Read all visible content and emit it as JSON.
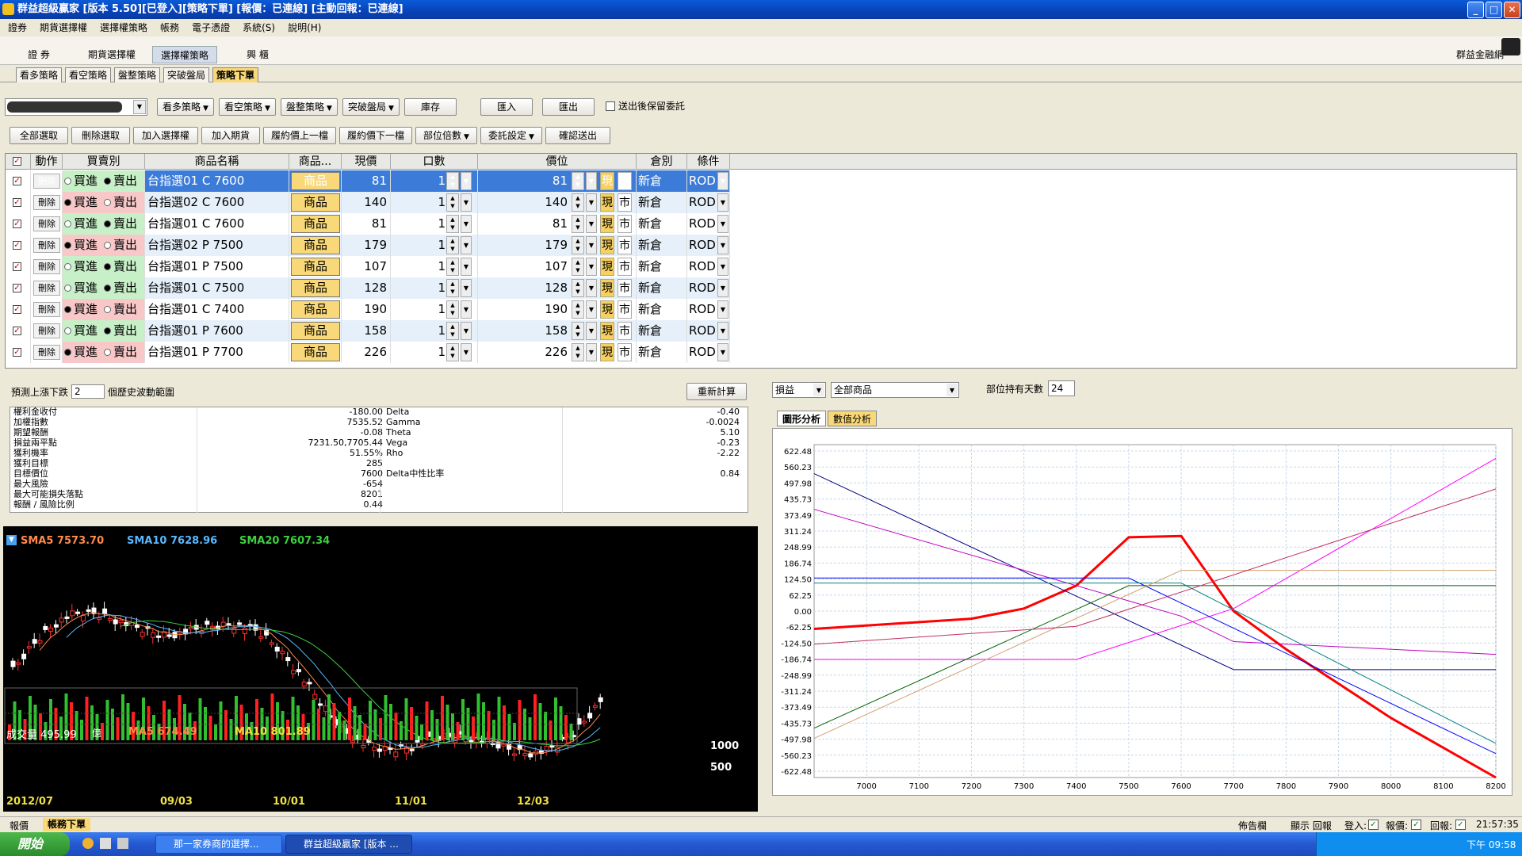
{
  "window": {
    "title": "群益超級贏家 [版本 5.50][已登入][策略下單] [報價：已連線] [主動回報：已連線]"
  },
  "menu": [
    "證券",
    "期貨選擇權",
    "選擇權策略",
    "帳務",
    "電子憑證",
    "系統(S)",
    "說明(H)"
  ],
  "main_tabs": [
    "證 券",
    "期貨選擇權",
    "選擇權策略",
    "興 櫃"
  ],
  "brand": "群益金融網",
  "strategy_tabs": [
    "看多策略",
    "看空策略",
    "盤整策略",
    "突破盤局",
    "策略下單"
  ],
  "toolbar1": [
    "看多策略",
    "看空策略",
    "盤整策略",
    "突破盤局",
    "庫存",
    "匯入",
    "匯出"
  ],
  "keep_order_label": "送出後保留委託",
  "toolbar2": [
    "全部選取",
    "刪除選取",
    "加入選擇權",
    "加入期貨",
    "履約價上一檔",
    "履約價下一檔",
    "部位倍數",
    "委託設定",
    "確認送出"
  ],
  "headers": [
    "動作",
    "買賣別",
    "商品名稱",
    "商品...",
    "現價",
    "口數",
    "價位",
    "倉別",
    "條件"
  ],
  "texts": {
    "del": "刪除",
    "buy": "買進",
    "sell": "賣出",
    "prod": "商品",
    "xian": "現",
    "shi": "市",
    "new": "新倉",
    "rod": "ROD"
  },
  "rows": [
    {
      "name": "台指選01 C 7600",
      "side": "sell",
      "price": "81",
      "qty": "1",
      "limit": "81"
    },
    {
      "name": "台指選02 C 7600",
      "side": "buy",
      "price": "140",
      "qty": "1",
      "limit": "140"
    },
    {
      "name": "台指選01 C 7600",
      "side": "sell",
      "price": "81",
      "qty": "1",
      "limit": "81"
    },
    {
      "name": "台指選02 P 7500",
      "side": "buy",
      "price": "179",
      "qty": "1",
      "limit": "179"
    },
    {
      "name": "台指選01 P 7500",
      "side": "sell",
      "price": "107",
      "qty": "1",
      "limit": "107"
    },
    {
      "name": "台指選01 C 7500",
      "side": "sell",
      "price": "128",
      "qty": "1",
      "limit": "128"
    },
    {
      "name": "台指選01 C 7400",
      "side": "buy",
      "price": "190",
      "qty": "1",
      "limit": "190"
    },
    {
      "name": "台指選01 P 7600",
      "side": "sell",
      "price": "158",
      "qty": "1",
      "limit": "158"
    },
    {
      "name": "台指選01 P 7700",
      "side": "buy",
      "price": "226",
      "qty": "1",
      "limit": "226"
    }
  ],
  "forecast": {
    "label_a": "預測上漲下跌",
    "value": "2",
    "label_b": "個歷史波動範圍",
    "recalc": "重新計算"
  },
  "stats_left": [
    [
      "權利金收付",
      "-180.00"
    ],
    [
      "加權指數",
      "7535.52"
    ],
    [
      "期望報酬",
      "-0.08"
    ],
    [
      "損益兩平點",
      "7231.50,7705.44"
    ],
    [
      "獲利機率",
      "51.55%"
    ],
    [
      "獲利目標",
      "285"
    ],
    [
      "目標價位",
      "7600"
    ],
    [
      "最大風險",
      "-654"
    ],
    [
      "最大可能損失落點",
      "8201"
    ],
    [
      "報酬 / 風險比例",
      "0.44"
    ]
  ],
  "stats_right": [
    [
      "Delta",
      "-0.40"
    ],
    [
      "Gamma",
      "-0.0024"
    ],
    [
      "Theta",
      "5.10"
    ],
    [
      "Vega",
      "-0.23"
    ],
    [
      "Rho",
      "-2.22"
    ],
    [
      "",
      ""
    ],
    [
      "Delta中性比率",
      "0.84"
    ]
  ],
  "kline": {
    "sma5": "SMA5 7573.70",
    "sma10": "SMA10 7628.96",
    "sma20": "SMA20 7607.34",
    "vol": "成交量 495.99",
    "vol_u": "億",
    "ma5": "MA5 674.49",
    "ma10": "MA10 801.89",
    "v1000": "1000",
    "v500": "500",
    "dates": [
      "2012/07",
      "09/03",
      "10/01",
      "11/01",
      "12/03"
    ]
  },
  "analysis": {
    "sel1": "損益",
    "sel2": "全部商品",
    "days_label": "部位持有天數",
    "days": "24",
    "tab1": "圖形分析",
    "tab2": "數值分析"
  },
  "chart_data": {
    "type": "line",
    "x": [
      7000,
      7100,
      7200,
      7300,
      7400,
      7500,
      7600,
      7700,
      7800,
      7900,
      8000,
      8100,
      8200
    ],
    "ylim": [
      -654,
      654
    ],
    "xlim": [
      6900,
      8200
    ],
    "yticks": [
      "622.48",
      "560.23",
      "497.98",
      "435.73",
      "373.49",
      "311.24",
      "248.99",
      "186.74",
      "124.50",
      "62.25",
      "0.00",
      "-62.25",
      "-124.50",
      "-186.74",
      "-248.99",
      "-311.24",
      "-373.49",
      "-435.73",
      "-497.98",
      "-560.23",
      "-622.48"
    ],
    "series": [
      {
        "color": "#ff0000",
        "points": [
          [
            6900,
            -70
          ],
          [
            7200,
            -30
          ],
          [
            7300,
            10
          ],
          [
            7400,
            100
          ],
          [
            7500,
            290
          ],
          [
            7600,
            295
          ],
          [
            7700,
            0
          ],
          [
            7800,
            -150
          ],
          [
            8000,
            -420
          ],
          [
            8200,
            -654
          ]
        ]
      },
      {
        "color": "#000080",
        "points": [
          [
            6900,
            540
          ],
          [
            7700,
            -230
          ],
          [
            8200,
            -230
          ]
        ]
      },
      {
        "color": "#ff00ff",
        "points": [
          [
            6900,
            -190
          ],
          [
            7400,
            -190
          ],
          [
            7700,
            10
          ],
          [
            8200,
            600
          ]
        ]
      },
      {
        "color": "#c000c0",
        "points": [
          [
            6900,
            400
          ],
          [
            7600,
            -20
          ],
          [
            7700,
            -120
          ],
          [
            8200,
            -170
          ]
        ]
      },
      {
        "color": "#0000ff",
        "points": [
          [
            6900,
            130
          ],
          [
            7500,
            130
          ],
          [
            8200,
            -560
          ]
        ]
      },
      {
        "color": "#008080",
        "points": [
          [
            6900,
            110
          ],
          [
            7600,
            110
          ],
          [
            8200,
            -520
          ]
        ]
      },
      {
        "color": "#006400",
        "points": [
          [
            6900,
            -460
          ],
          [
            7500,
            100
          ],
          [
            8200,
            100
          ]
        ]
      },
      {
        "color": "#d2a070",
        "points": [
          [
            6900,
            -500
          ],
          [
            7600,
            160
          ],
          [
            8200,
            160
          ]
        ]
      },
      {
        "color": "#c03060",
        "points": [
          [
            6900,
            -130
          ],
          [
            7400,
            -60
          ],
          [
            8200,
            480
          ]
        ]
      }
    ]
  },
  "status": {
    "items": [
      "報價",
      "帳務下單"
    ],
    "r1": "佈告欄",
    "r2": "顯示 回報",
    "r3": "登入:",
    "r4": "報價:",
    "r5": "回報:",
    "time": "21:57:35"
  },
  "taskbar": {
    "start": "開始",
    "t1": "那一家券商的選擇...",
    "t2": "群益超級贏家 [版本 ...",
    "clock": "下午 09:58"
  }
}
